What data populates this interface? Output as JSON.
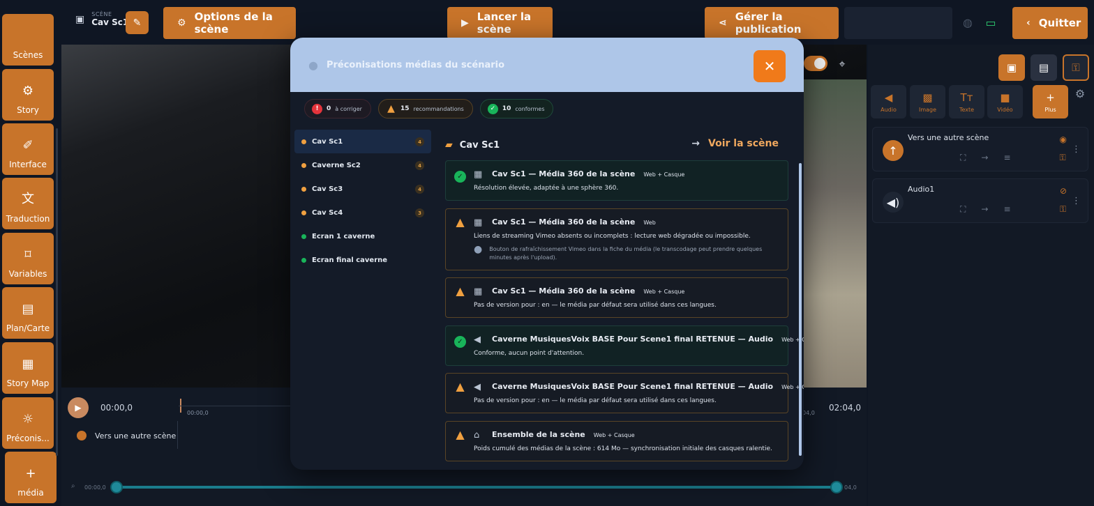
{
  "topbar": {
    "scene_small": "SCÈNE",
    "scene_name": "Cav Sc1",
    "options_label": "Options de la scène",
    "launch_label": "Lancer la scène",
    "publish_label": "Gérer la publication",
    "quit_label": "Quitter"
  },
  "sidebar": {
    "items": [
      {
        "label": "Scènes",
        "icon": "layers-icon"
      },
      {
        "label": "Story",
        "icon": "gear-icon"
      },
      {
        "label": "Interface",
        "icon": "brush-icon"
      },
      {
        "label": "Traduction",
        "icon": "translate-icon"
      },
      {
        "label": "Variables",
        "icon": "bookmark-icon"
      },
      {
        "label": "Plan/Carte",
        "icon": "map-icon"
      },
      {
        "label": "Story Map",
        "icon": "storymap-icon"
      },
      {
        "label": "Préconis...",
        "icon": "bulb-icon"
      },
      {
        "label": "média",
        "icon": "plus-icon"
      }
    ]
  },
  "timeline": {
    "start_time": "00:00,0",
    "cursor_time": "00:00,0",
    "end_time": "02:04,0",
    "end_small": "04,0",
    "track_label": "Vers une autre scène",
    "zoom_start": "00:00,0",
    "zoom_end": "04,0"
  },
  "right_panel": {
    "media_tabs": [
      {
        "label": "Audio",
        "icon": "speaker-icon"
      },
      {
        "label": "Image",
        "icon": "image-icon"
      },
      {
        "label": "Texte",
        "icon": "text-icon"
      },
      {
        "label": "Vidéo",
        "icon": "video-icon"
      },
      {
        "label": "Plus",
        "icon": "plus-icon"
      }
    ],
    "layers": [
      {
        "name": "Vers une autre scène",
        "icon": "arrow-up-icon"
      },
      {
        "name": "Audio1",
        "icon": "speaker-icon"
      }
    ]
  },
  "modal": {
    "title": "Préconisations médias du scénario",
    "counts": [
      {
        "value": "0",
        "label": "à corriger",
        "color": "#e5343c"
      },
      {
        "value": "15",
        "label": "recommandations",
        "color": "#f0a040"
      },
      {
        "value": "10",
        "label": "conformes",
        "color": "#19b45a"
      }
    ],
    "scenes": [
      {
        "name": "Cav Sc1",
        "count": "4",
        "status": "warn"
      },
      {
        "name": "Caverne Sc2",
        "count": "4",
        "status": "warn"
      },
      {
        "name": "Cav Sc3",
        "count": "4",
        "status": "warn"
      },
      {
        "name": "Cav Sc4",
        "count": "3",
        "status": "warn"
      },
      {
        "name": "Ecran 1 caverne",
        "count": "",
        "status": "ok"
      },
      {
        "name": "Ecran final caverne",
        "count": "",
        "status": "ok"
      }
    ],
    "detail_title": "Cav Sc1",
    "voir_label": "Voir la scène",
    "cards": [
      {
        "status": "ok",
        "type_icon": "clapper-icon",
        "title": "Cav Sc1 — Média 360 de la scène",
        "tag": "Web + Casque",
        "desc": "Résolution élevée, adaptée à une sphère 360.",
        "tip": ""
      },
      {
        "status": "warn",
        "type_icon": "clapper-icon",
        "title": "Cav Sc1 — Média 360 de la scène",
        "tag": "Web",
        "desc": "Liens de streaming Vimeo absents ou incomplets : lecture web dégradée ou impossible.",
        "tip": "Bouton de rafraîchissement Vimeo dans la fiche du média (le transcodage peut prendre quelques minutes après l'upload)."
      },
      {
        "status": "warn",
        "type_icon": "clapper-icon",
        "title": "Cav Sc1 — Média 360 de la scène",
        "tag": "Web + Casque",
        "desc": "Pas de version pour : en — le média par défaut sera utilisé dans ces langues.",
        "tip": ""
      },
      {
        "status": "ok",
        "type_icon": "speaker-icon",
        "title": "Caverne MusiquesVoix BASE Pour Scene1 final RETENUE — Audio",
        "tag": "Web + Casque",
        "desc": "Conforme, aucun point d'attention.",
        "tip": ""
      },
      {
        "status": "warn",
        "type_icon": "speaker-icon",
        "title": "Caverne MusiquesVoix BASE Pour Scene1 final RETENUE — Audio",
        "tag": "Web + Casque",
        "desc": "Pas de version pour : en — le média par défaut sera utilisé dans ces langues.",
        "tip": ""
      },
      {
        "status": "warn",
        "type_icon": "ensemble-icon",
        "title": "Ensemble de la scène",
        "tag": "Web + Casque",
        "desc": "Poids cumulé des médias de la scène : 614 Mo — synchronisation initiale des casques ralentie.",
        "tip": ""
      }
    ]
  },
  "colors": {
    "accent": "#c8742a",
    "close": "#f07a1a",
    "ok": "#19b45a",
    "warn": "#f0a040",
    "error": "#e5343c"
  }
}
